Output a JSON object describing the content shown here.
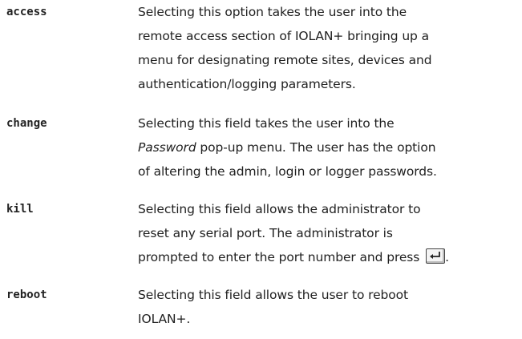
{
  "entries": [
    {
      "term": "access",
      "lines": [
        "Selecting this option takes the user into the",
        "remote access section of IOLAN+ bringing up a",
        "menu for designating remote sites, devices and",
        "authentication/logging parameters."
      ]
    },
    {
      "term": "change",
      "line1": "Selecting this field takes the user into the",
      "line2_em": "Password",
      "line2_rest": " pop-up menu.  The user has the option",
      "line3": "of altering the admin, login or logger passwords."
    },
    {
      "term": "kill",
      "lines": [
        "Selecting this field allows the administrator to",
        "reset any serial port. The administrator is",
        "prompted to enter the port number and press"
      ],
      "trailing": ".",
      "key_icon": "enter-key-icon"
    },
    {
      "term": "reboot",
      "lines": [
        "Selecting this field allows the user to reboot",
        "IOLAN+."
      ]
    }
  ]
}
